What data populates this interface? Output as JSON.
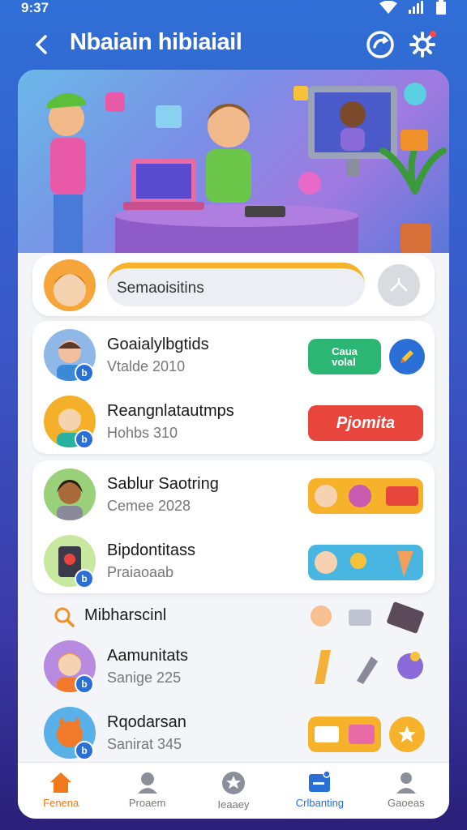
{
  "status_bar": {
    "time": "9:37"
  },
  "app_bar": {
    "title": "Nbaiain hibiaiail"
  },
  "search": {
    "placeholder": "Semaoisitins"
  },
  "group1": [
    {
      "title": "Goaialylbgtids",
      "subtitle": "Vtalde 2010",
      "chip_text": "Caua\nvolal",
      "chip_color": "#2bb673"
    },
    {
      "title": "Reangnlatautmps",
      "subtitle": "Hohbs 310",
      "chip_text": "Pjomita",
      "chip_color": "#e8453c"
    }
  ],
  "group2": [
    {
      "title": "Sablur Saotring",
      "subtitle": "Cemee 2028",
      "chip_color": "#f5b22a"
    },
    {
      "title": "Bipdontitass",
      "subtitle": "Praiaoaab",
      "chip_color": "#48b6e0"
    }
  ],
  "section": {
    "title": "Mibharscinl"
  },
  "group3": [
    {
      "title": "Aamunitats",
      "subtitle": "Sanige 225"
    },
    {
      "title": "Rqodarsan",
      "subtitle": "Sanirat 345",
      "chip_color": "#f5b22a"
    }
  ],
  "bottom_nav": [
    {
      "label": "Fenena",
      "icon": "home-icon"
    },
    {
      "label": "Proaem",
      "icon": "profile-icon"
    },
    {
      "label": "Ieaaey",
      "icon": "star-icon"
    },
    {
      "label": "Crlbanting",
      "icon": "card-icon"
    },
    {
      "label": "Gaoeas",
      "icon": "person-icon"
    }
  ],
  "colors": {
    "accent": "#2a6fd6",
    "home_active": "#f07a1a",
    "search_border": "#f5b22a"
  }
}
